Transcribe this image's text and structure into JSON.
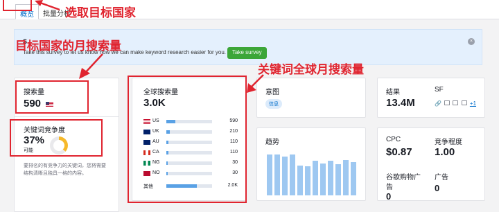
{
  "tabs": [
    {
      "label": "概览"
    },
    {
      "label": "批量分析"
    }
  ],
  "banner": {
    "title": "S",
    "text": "Take this survey to let us know how we can make keyword research easier for you.",
    "button": "Take survey",
    "close": "×"
  },
  "volume": {
    "label": "搜索量",
    "value": "590"
  },
  "difficulty": {
    "label": "关键词竞争度",
    "value": "37%",
    "level": "可能",
    "percent": 37,
    "desc_line1": "要排名的有竞争力的关键词，您将需要",
    "desc_line2": "结构清晰且独具一格的内容。"
  },
  "global": {
    "label": "全球搜索量",
    "value": "3.0K",
    "countries": [
      {
        "code": "US",
        "value": "590",
        "share": 0.2
      },
      {
        "code": "UK",
        "value": "210",
        "share": 0.07
      },
      {
        "code": "AU",
        "value": "110",
        "share": 0.04
      },
      {
        "code": "CA",
        "value": "110",
        "share": 0.04
      },
      {
        "code": "NG",
        "value": "30",
        "share": 0.01
      },
      {
        "code": "NO",
        "value": "30",
        "share": 0.01
      }
    ],
    "other_label": "其他",
    "other_value": "2.0K",
    "other_share": 0.67
  },
  "intent": {
    "label": "意图",
    "tag": "信息"
  },
  "results": {
    "label": "结果",
    "value": "13.4M",
    "sf_label": "SF",
    "sf_more": "+1"
  },
  "trend": {
    "label": "趋势",
    "values": [
      0.95,
      0.95,
      0.9,
      0.95,
      0.7,
      0.68,
      0.8,
      0.75,
      0.8,
      0.72,
      0.82,
      0.78
    ]
  },
  "cpc": {
    "label": "CPC",
    "value": "$0.87"
  },
  "competition": {
    "label": "竞争程度",
    "value": "1.00"
  },
  "shopping": {
    "label_line1": "谷歌购物广",
    "label_line2": "告",
    "value": "0"
  },
  "ads": {
    "label": "广告",
    "value": "0"
  },
  "annotations": {
    "select_country": "选取目标国家",
    "monthly_volume": "目标国家的月搜索量",
    "global_volume": "关键词全球月搜索量"
  },
  "colors": {
    "accent": "#006dca",
    "annotation": "#e0242f",
    "bar": "#59a1e5",
    "donut": "#f6b92b",
    "survey_button": "#3ca638"
  }
}
